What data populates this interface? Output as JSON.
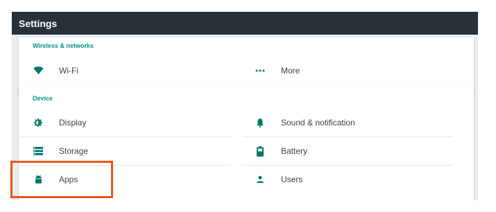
{
  "toolbar": {
    "title": "Settings"
  },
  "wireless": {
    "header": "Wireless & networks",
    "items": [
      {
        "label": "Wi-Fi",
        "icon": "wifi-icon"
      },
      {
        "label": "More",
        "icon": "more-horiz-icon"
      }
    ]
  },
  "device": {
    "header": "Device",
    "items": [
      {
        "label": "Display",
        "icon": "brightness-icon"
      },
      {
        "label": "Sound & notification",
        "icon": "bell-icon"
      },
      {
        "label": "Storage",
        "icon": "storage-icon"
      },
      {
        "label": "Battery",
        "icon": "battery-icon"
      },
      {
        "label": "Apps",
        "icon": "android-icon"
      },
      {
        "label": "Users",
        "icon": "person-icon"
      }
    ]
  },
  "colors": {
    "toolbar": "#263238",
    "accent": "#009688",
    "icon": "#00796b",
    "highlight": "#e8571b"
  }
}
